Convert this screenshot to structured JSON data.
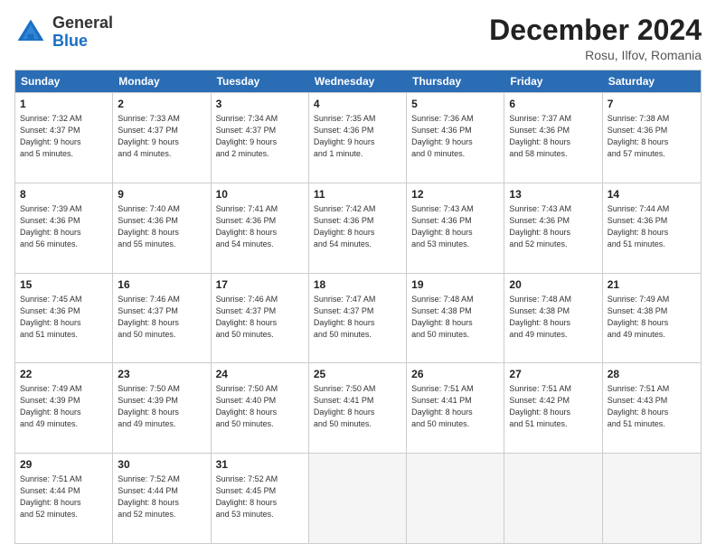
{
  "header": {
    "logo_general": "General",
    "logo_blue": "Blue",
    "month_title": "December 2024",
    "location": "Rosu, Ilfov, Romania"
  },
  "calendar": {
    "days_of_week": [
      "Sunday",
      "Monday",
      "Tuesday",
      "Wednesday",
      "Thursday",
      "Friday",
      "Saturday"
    ],
    "rows": [
      [
        {
          "day": "1",
          "lines": [
            "Sunrise: 7:32 AM",
            "Sunset: 4:37 PM",
            "Daylight: 9 hours",
            "and 5 minutes."
          ]
        },
        {
          "day": "2",
          "lines": [
            "Sunrise: 7:33 AM",
            "Sunset: 4:37 PM",
            "Daylight: 9 hours",
            "and 4 minutes."
          ]
        },
        {
          "day": "3",
          "lines": [
            "Sunrise: 7:34 AM",
            "Sunset: 4:37 PM",
            "Daylight: 9 hours",
            "and 2 minutes."
          ]
        },
        {
          "day": "4",
          "lines": [
            "Sunrise: 7:35 AM",
            "Sunset: 4:36 PM",
            "Daylight: 9 hours",
            "and 1 minute."
          ]
        },
        {
          "day": "5",
          "lines": [
            "Sunrise: 7:36 AM",
            "Sunset: 4:36 PM",
            "Daylight: 9 hours",
            "and 0 minutes."
          ]
        },
        {
          "day": "6",
          "lines": [
            "Sunrise: 7:37 AM",
            "Sunset: 4:36 PM",
            "Daylight: 8 hours",
            "and 58 minutes."
          ]
        },
        {
          "day": "7",
          "lines": [
            "Sunrise: 7:38 AM",
            "Sunset: 4:36 PM",
            "Daylight: 8 hours",
            "and 57 minutes."
          ]
        }
      ],
      [
        {
          "day": "8",
          "lines": [
            "Sunrise: 7:39 AM",
            "Sunset: 4:36 PM",
            "Daylight: 8 hours",
            "and 56 minutes."
          ]
        },
        {
          "day": "9",
          "lines": [
            "Sunrise: 7:40 AM",
            "Sunset: 4:36 PM",
            "Daylight: 8 hours",
            "and 55 minutes."
          ]
        },
        {
          "day": "10",
          "lines": [
            "Sunrise: 7:41 AM",
            "Sunset: 4:36 PM",
            "Daylight: 8 hours",
            "and 54 minutes."
          ]
        },
        {
          "day": "11",
          "lines": [
            "Sunrise: 7:42 AM",
            "Sunset: 4:36 PM",
            "Daylight: 8 hours",
            "and 54 minutes."
          ]
        },
        {
          "day": "12",
          "lines": [
            "Sunrise: 7:43 AM",
            "Sunset: 4:36 PM",
            "Daylight: 8 hours",
            "and 53 minutes."
          ]
        },
        {
          "day": "13",
          "lines": [
            "Sunrise: 7:43 AM",
            "Sunset: 4:36 PM",
            "Daylight: 8 hours",
            "and 52 minutes."
          ]
        },
        {
          "day": "14",
          "lines": [
            "Sunrise: 7:44 AM",
            "Sunset: 4:36 PM",
            "Daylight: 8 hours",
            "and 51 minutes."
          ]
        }
      ],
      [
        {
          "day": "15",
          "lines": [
            "Sunrise: 7:45 AM",
            "Sunset: 4:36 PM",
            "Daylight: 8 hours",
            "and 51 minutes."
          ]
        },
        {
          "day": "16",
          "lines": [
            "Sunrise: 7:46 AM",
            "Sunset: 4:37 PM",
            "Daylight: 8 hours",
            "and 50 minutes."
          ]
        },
        {
          "day": "17",
          "lines": [
            "Sunrise: 7:46 AM",
            "Sunset: 4:37 PM",
            "Daylight: 8 hours",
            "and 50 minutes."
          ]
        },
        {
          "day": "18",
          "lines": [
            "Sunrise: 7:47 AM",
            "Sunset: 4:37 PM",
            "Daylight: 8 hours",
            "and 50 minutes."
          ]
        },
        {
          "day": "19",
          "lines": [
            "Sunrise: 7:48 AM",
            "Sunset: 4:38 PM",
            "Daylight: 8 hours",
            "and 50 minutes."
          ]
        },
        {
          "day": "20",
          "lines": [
            "Sunrise: 7:48 AM",
            "Sunset: 4:38 PM",
            "Daylight: 8 hours",
            "and 49 minutes."
          ]
        },
        {
          "day": "21",
          "lines": [
            "Sunrise: 7:49 AM",
            "Sunset: 4:38 PM",
            "Daylight: 8 hours",
            "and 49 minutes."
          ]
        }
      ],
      [
        {
          "day": "22",
          "lines": [
            "Sunrise: 7:49 AM",
            "Sunset: 4:39 PM",
            "Daylight: 8 hours",
            "and 49 minutes."
          ]
        },
        {
          "day": "23",
          "lines": [
            "Sunrise: 7:50 AM",
            "Sunset: 4:39 PM",
            "Daylight: 8 hours",
            "and 49 minutes."
          ]
        },
        {
          "day": "24",
          "lines": [
            "Sunrise: 7:50 AM",
            "Sunset: 4:40 PM",
            "Daylight: 8 hours",
            "and 50 minutes."
          ]
        },
        {
          "day": "25",
          "lines": [
            "Sunrise: 7:50 AM",
            "Sunset: 4:41 PM",
            "Daylight: 8 hours",
            "and 50 minutes."
          ]
        },
        {
          "day": "26",
          "lines": [
            "Sunrise: 7:51 AM",
            "Sunset: 4:41 PM",
            "Daylight: 8 hours",
            "and 50 minutes."
          ]
        },
        {
          "day": "27",
          "lines": [
            "Sunrise: 7:51 AM",
            "Sunset: 4:42 PM",
            "Daylight: 8 hours",
            "and 51 minutes."
          ]
        },
        {
          "day": "28",
          "lines": [
            "Sunrise: 7:51 AM",
            "Sunset: 4:43 PM",
            "Daylight: 8 hours",
            "and 51 minutes."
          ]
        }
      ],
      [
        {
          "day": "29",
          "lines": [
            "Sunrise: 7:51 AM",
            "Sunset: 4:44 PM",
            "Daylight: 8 hours",
            "and 52 minutes."
          ]
        },
        {
          "day": "30",
          "lines": [
            "Sunrise: 7:52 AM",
            "Sunset: 4:44 PM",
            "Daylight: 8 hours",
            "and 52 minutes."
          ]
        },
        {
          "day": "31",
          "lines": [
            "Sunrise: 7:52 AM",
            "Sunset: 4:45 PM",
            "Daylight: 8 hours",
            "and 53 minutes."
          ]
        },
        {
          "day": "",
          "lines": []
        },
        {
          "day": "",
          "lines": []
        },
        {
          "day": "",
          "lines": []
        },
        {
          "day": "",
          "lines": []
        }
      ]
    ]
  }
}
